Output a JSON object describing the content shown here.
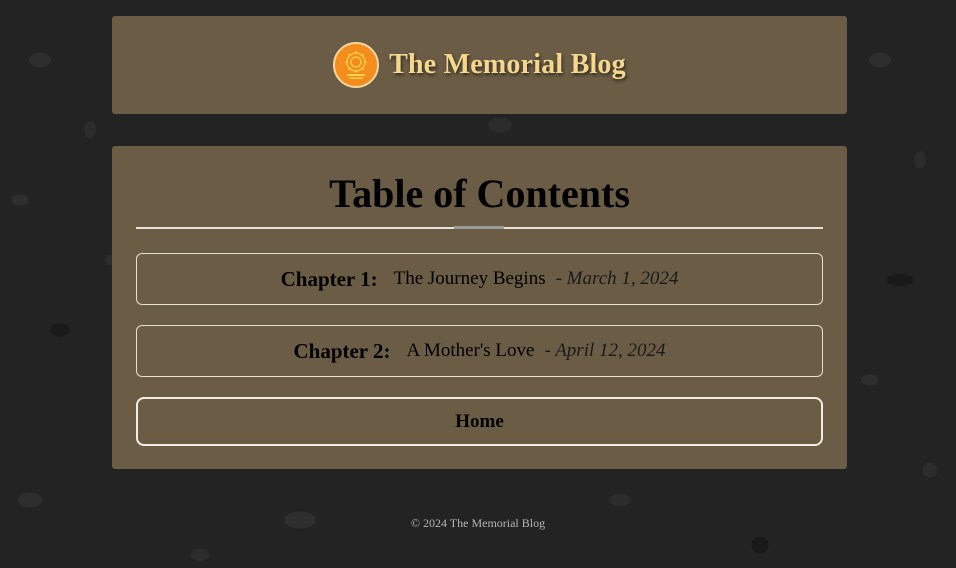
{
  "header": {
    "title": "The Memorial Blog",
    "logo_icon": "sunflower-logo-icon"
  },
  "toc": {
    "title": "Table of Contents",
    "chapters": [
      {
        "number": "Chapter 1:",
        "name": "The Journey Begins",
        "date": "- March 1, 2024"
      },
      {
        "number": "Chapter 2:",
        "name": "A Mother's Love",
        "date": "- April 12, 2024"
      }
    ],
    "home_label": "Home"
  },
  "footer": {
    "text": "© 2024 The Memorial Blog"
  },
  "colors": {
    "panel": "#6b5d45",
    "title_gold": "#f5d78e",
    "logo_orange": "#f48d1c",
    "background": "#232323"
  }
}
